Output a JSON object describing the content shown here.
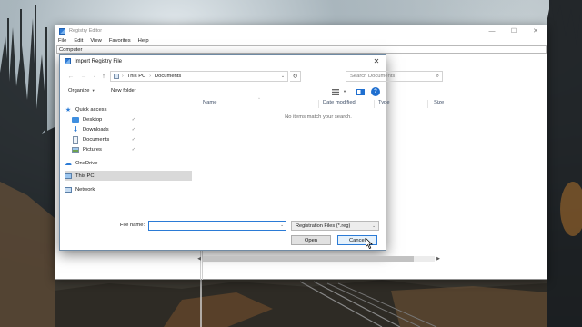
{
  "registry_editor": {
    "title": "Registry Editor",
    "menu": [
      "File",
      "Edit",
      "View",
      "Favorites",
      "Help"
    ],
    "address": "Computer",
    "controls": {
      "minimize": "—",
      "maximize": "☐",
      "close": "✕"
    }
  },
  "dialog": {
    "title": "Import Registry File",
    "close_glyph": "✕",
    "breadcrumb": [
      "This PC",
      "Documents"
    ],
    "search_placeholder": "Search Documents",
    "toolbar": {
      "organize": "Organize",
      "new_folder": "New folder"
    },
    "nav_items": [
      {
        "label": "Quick access",
        "icon": "star-icon"
      },
      {
        "label": "Desktop",
        "icon": "desktop-folder-icon",
        "pinned": true
      },
      {
        "label": "Downloads",
        "icon": "downloads-icon",
        "pinned": true
      },
      {
        "label": "Documents",
        "icon": "documents-icon",
        "pinned": true
      },
      {
        "label": "Pictures",
        "icon": "pictures-icon",
        "pinned": true
      },
      {
        "label": "OneDrive",
        "icon": "cloud-icon"
      },
      {
        "label": "This PC",
        "icon": "computer-icon",
        "selected": true
      },
      {
        "label": "Network",
        "icon": "network-icon"
      }
    ],
    "columns": [
      "Name",
      "Date modified",
      "Type",
      "Size"
    ],
    "empty_message": "No items match your search.",
    "file_name_label": "File name:",
    "file_name_value": "",
    "file_type": "Registration Files (*.reg)",
    "open_label": "Open",
    "cancel_label": "Cancel"
  },
  "colors": {
    "accent": "#2b7bd6",
    "selected_bg": "#d9d9d9",
    "help_blue": "#1f6fd0"
  }
}
